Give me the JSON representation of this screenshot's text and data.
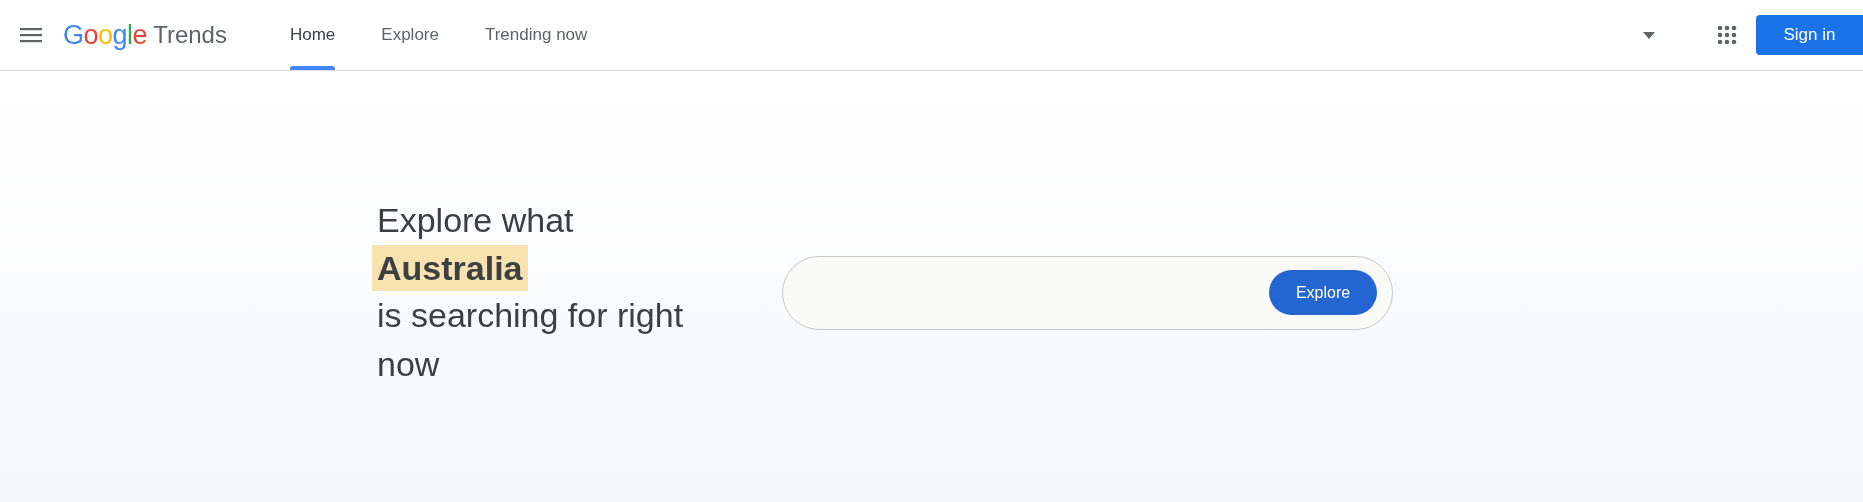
{
  "header": {
    "logo": "Google",
    "product": "Trends",
    "tabs": [
      {
        "label": "Home",
        "selected": true
      },
      {
        "label": "Explore",
        "selected": false
      },
      {
        "label": "Trending now",
        "selected": false
      }
    ],
    "sign_in": "Sign in"
  },
  "hero": {
    "heading": "Explore what **Australia** is searching for right now",
    "search": {
      "button": "Explore"
    }
  }
}
